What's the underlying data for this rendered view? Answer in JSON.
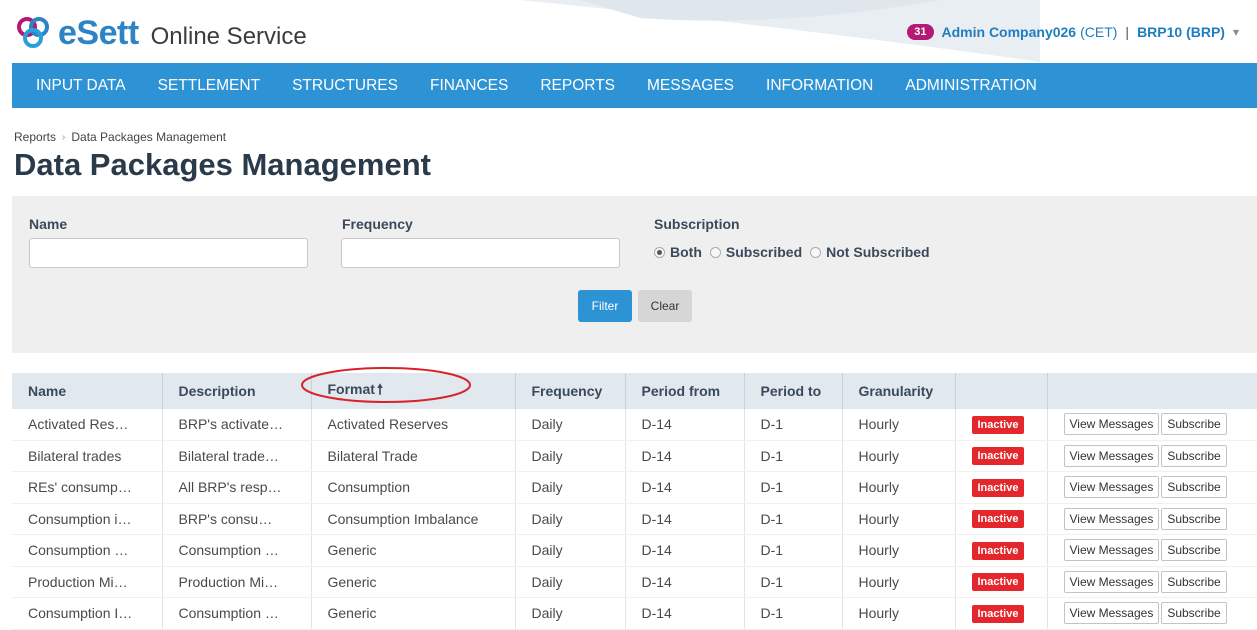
{
  "header": {
    "brand": "eSett",
    "subtitle": "Online Service",
    "notification_count": "31",
    "user_name": "Admin Company026",
    "timezone": "(CET)",
    "separator": "|",
    "role": "BRP10 (BRP)",
    "brand_color": "#2c84c6",
    "badge_color": "#b41a75"
  },
  "nav": {
    "color": "#2e93d4",
    "items": [
      {
        "label": "INPUT DATA"
      },
      {
        "label": "SETTLEMENT"
      },
      {
        "label": "STRUCTURES"
      },
      {
        "label": "FINANCES"
      },
      {
        "label": "REPORTS"
      },
      {
        "label": "MESSAGES"
      },
      {
        "label": "INFORMATION"
      },
      {
        "label": "ADMINISTRATION"
      }
    ]
  },
  "breadcrumb": {
    "items": [
      {
        "label": "Reports"
      },
      {
        "label": "Data Packages Management"
      }
    ]
  },
  "page": {
    "title": "Data Packages Management"
  },
  "filters": {
    "name_label": "Name",
    "name_value": "",
    "frequency_label": "Frequency",
    "frequency_value": "",
    "subscription_label": "Subscription",
    "subscription_options": [
      {
        "label": "Both",
        "selected": true
      },
      {
        "label": "Subscribed",
        "selected": false
      },
      {
        "label": "Not Subscribed",
        "selected": false
      }
    ],
    "filter_button": "Filter",
    "clear_button": "Clear"
  },
  "table": {
    "columns": [
      {
        "label": "Name"
      },
      {
        "label": "Description"
      },
      {
        "label": "Format",
        "sorted": "ascending"
      },
      {
        "label": "Frequency"
      },
      {
        "label": "Period from"
      },
      {
        "label": "Period to"
      },
      {
        "label": "Granularity"
      },
      {
        "label": ""
      },
      {
        "label": ""
      }
    ],
    "sort_icon": "arrow-up-icon",
    "status_color": "#e4272d",
    "view_messages_label": "View Messages",
    "subscribe_label": "Subscribe",
    "rows": [
      {
        "name": "Activated Res…",
        "description": "BRP's activate…",
        "format": "Activated Reserves",
        "frequency": "Daily",
        "period_from": "D-14",
        "period_to": "D-1",
        "granularity": "Hourly",
        "status": "Inactive"
      },
      {
        "name": "Bilateral trades",
        "description": "Bilateral trade…",
        "format": "Bilateral Trade",
        "frequency": "Daily",
        "period_from": "D-14",
        "period_to": "D-1",
        "granularity": "Hourly",
        "status": "Inactive"
      },
      {
        "name": "REs' consump…",
        "description": "All BRP's resp…",
        "format": "Consumption",
        "frequency": "Daily",
        "period_from": "D-14",
        "period_to": "D-1",
        "granularity": "Hourly",
        "status": "Inactive"
      },
      {
        "name": "Consumption i…",
        "description": "BRP's consu…",
        "format": "Consumption Imbalance",
        "frequency": "Daily",
        "period_from": "D-14",
        "period_to": "D-1",
        "granularity": "Hourly",
        "status": "Inactive"
      },
      {
        "name": "Consumption …",
        "description": "Consumption …",
        "format": "Generic",
        "frequency": "Daily",
        "period_from": "D-14",
        "period_to": "D-1",
        "granularity": "Hourly",
        "status": "Inactive"
      },
      {
        "name": "Production Mi…",
        "description": "Production Mi…",
        "format": "Generic",
        "frequency": "Daily",
        "period_from": "D-14",
        "period_to": "D-1",
        "granularity": "Hourly",
        "status": "Inactive"
      },
      {
        "name": "Consumption I…",
        "description": "Consumption …",
        "format": "Generic",
        "frequency": "Daily",
        "period_from": "D-14",
        "period_to": "D-1",
        "granularity": "Hourly",
        "status": "Inactive"
      }
    ]
  }
}
